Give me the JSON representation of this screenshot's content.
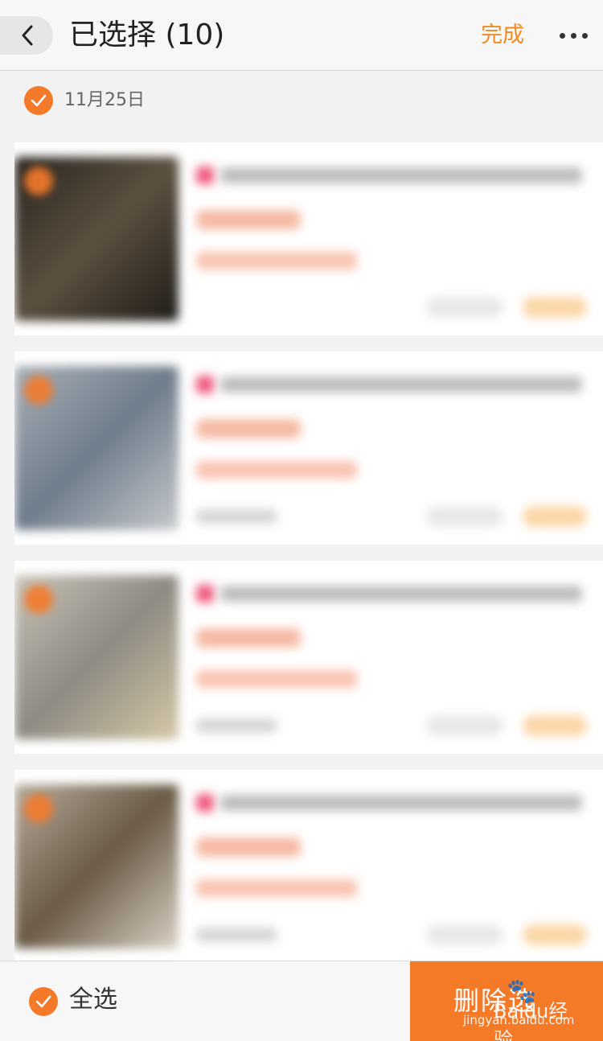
{
  "header": {
    "title": "已选择 (10)",
    "done_label": "完成"
  },
  "date_group": {
    "date": "11月25日"
  },
  "items": [
    {
      "thumb_colors": [
        "#2a2520",
        "#5c5040",
        "#1f1c18"
      ]
    },
    {
      "thumb_colors": [
        "#a7adb5",
        "#6f7d8c",
        "#c7c9cc"
      ]
    },
    {
      "thumb_colors": [
        "#c9c3b8",
        "#8e8a82",
        "#d6c9a8"
      ]
    },
    {
      "thumb_colors": [
        "#b7ab9b",
        "#6b5b47",
        "#d9d1c4"
      ]
    }
  ],
  "footer": {
    "select_all_label": "全选",
    "delete_label": "删除选"
  },
  "watermark": {
    "brand": "Baidu经验",
    "url": "jingyan.baidu.com"
  },
  "colors": {
    "accent": "#f47a28",
    "done": "#f28b20"
  }
}
